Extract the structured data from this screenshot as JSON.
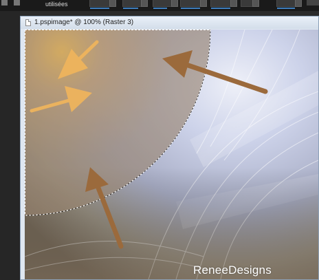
{
  "toolbar": {
    "label": "utilisées"
  },
  "document": {
    "title": "1.pspimage* @ 100% (Raster 3)",
    "watermark": "ReneeDesigns"
  },
  "colors": {
    "arrow": "#9b6a3c",
    "arrow_light": "#f0b55c",
    "selection": "#ffffff"
  },
  "icons": [
    "document-icon",
    "arrow-annotation",
    "selection-marquee"
  ]
}
